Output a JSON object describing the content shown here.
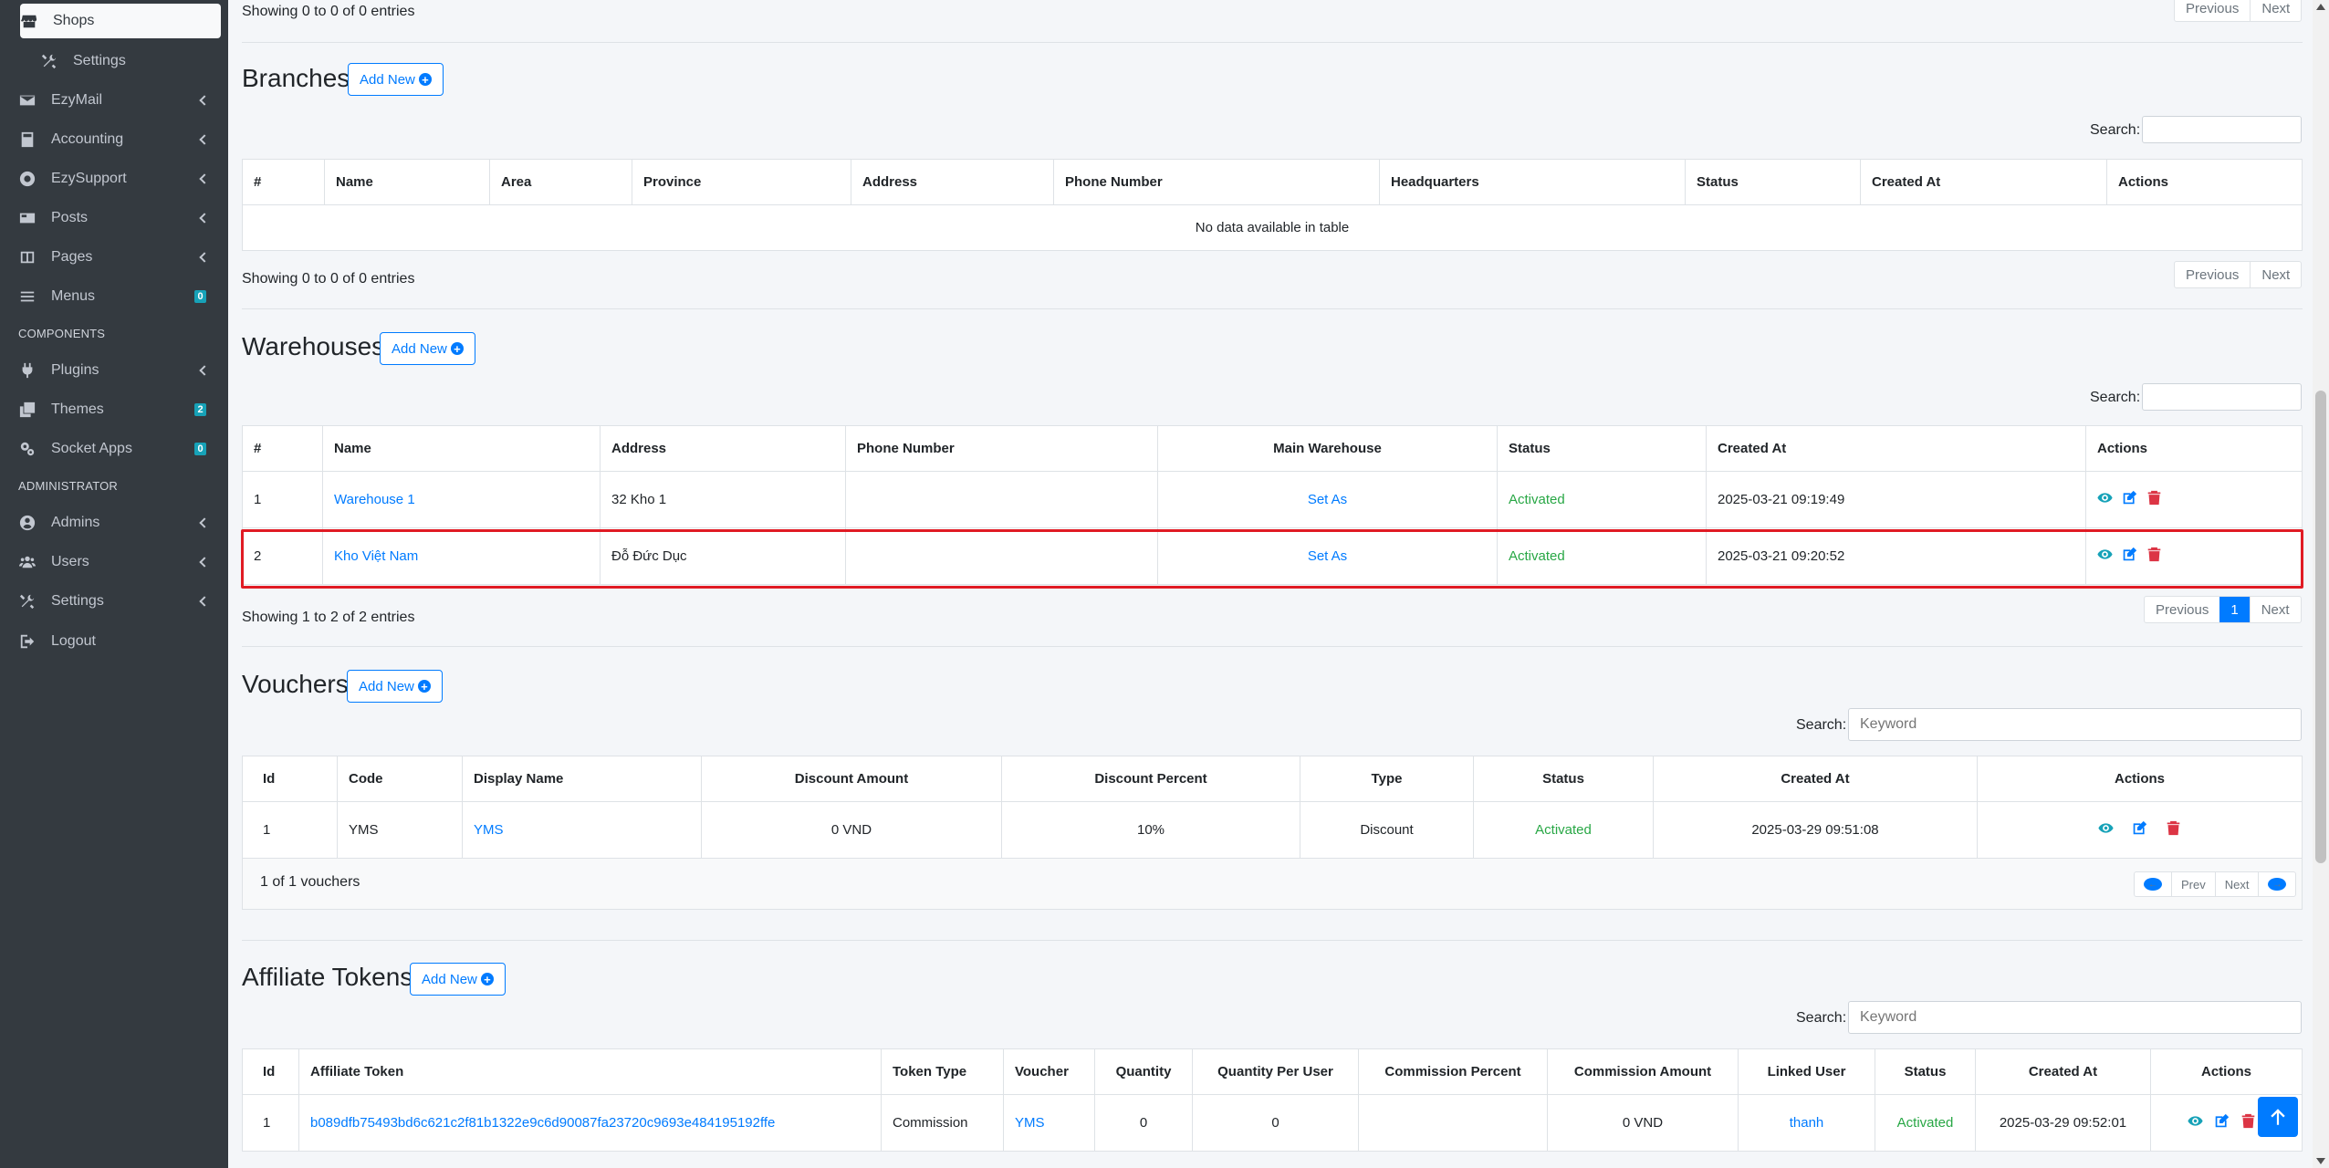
{
  "sidebar": {
    "items": [
      {
        "label": "Shops",
        "icon": "store-icon"
      },
      {
        "label": "Settings",
        "icon": "tools-icon"
      },
      {
        "label": "EzyMail",
        "icon": "envelope-icon"
      },
      {
        "label": "Accounting",
        "icon": "calculator-icon"
      },
      {
        "label": "EzySupport",
        "icon": "lifebuoy-icon"
      },
      {
        "label": "Posts",
        "icon": "newspaper-icon"
      },
      {
        "label": "Pages",
        "icon": "columns-icon"
      },
      {
        "label": "Menus",
        "icon": "bars-icon",
        "badge": "0"
      },
      {
        "label": "Plugins",
        "icon": "plug-icon"
      },
      {
        "label": "Themes",
        "icon": "clone-icon",
        "badge": "2"
      },
      {
        "label": "Socket Apps",
        "icon": "cogs-icon",
        "badge": "0"
      },
      {
        "label": "Admins",
        "icon": "user-circle-icon"
      },
      {
        "label": "Users",
        "icon": "users-icon"
      },
      {
        "label": "Settings",
        "icon": "tools-icon"
      },
      {
        "label": "Logout",
        "icon": "sign-out-icon"
      }
    ],
    "headers": {
      "components": "COMPONENTS",
      "administrator": "ADMINISTRATOR"
    }
  },
  "top": {
    "info": "Showing 0 to 0 of 0 entries",
    "prev": "Previous",
    "next": "Next"
  },
  "branches": {
    "title": "Branches",
    "add_label": "Add New",
    "search_label": "Search:",
    "columns": [
      "#",
      "Name",
      "Area",
      "Province",
      "Address",
      "Phone Number",
      "Headquarters",
      "Status",
      "Created At",
      "Actions"
    ],
    "empty": "No data available in table",
    "info": "Showing 0 to 0 of 0 entries",
    "prev": "Previous",
    "next": "Next"
  },
  "warehouses": {
    "title": "Warehouses",
    "add_label": "Add New",
    "search_label": "Search:",
    "columns": [
      "#",
      "Name",
      "Address",
      "Phone Number",
      "Main Warehouse",
      "Status",
      "Created At",
      "Actions"
    ],
    "rows": [
      {
        "id": "1",
        "name": "Warehouse 1",
        "address": "32 Kho 1",
        "phone": "",
        "main": "Set As",
        "status": "Activated",
        "created": "2025-03-21 09:19:49"
      },
      {
        "id": "2",
        "name": "Kho Việt Nam",
        "address": "Đỗ Đức Dục",
        "phone": "",
        "main": "Set As",
        "status": "Activated",
        "created": "2025-03-21 09:20:52"
      }
    ],
    "info": "Showing 1 to 2 of 2 entries",
    "prev": "Previous",
    "page": "1",
    "next": "Next"
  },
  "vouchers": {
    "title": "Vouchers",
    "add_label": "Add New",
    "search_label": "Search:",
    "search_placeholder": "Keyword",
    "columns": [
      "Id",
      "Code",
      "Display Name",
      "Discount Amount",
      "Discount Percent",
      "Type",
      "Status",
      "Created At",
      "Actions"
    ],
    "rows": [
      {
        "id": "1",
        "code": "YMS",
        "display": "YMS",
        "amount": "0 VND",
        "percent": "10%",
        "type": "Discount",
        "status": "Activated",
        "created": "2025-03-29 09:51:08"
      }
    ],
    "info": "1 of 1 vouchers",
    "prev": "Prev",
    "next": "Next"
  },
  "affiliate": {
    "title": "Affiliate Tokens",
    "add_label": "Add New",
    "search_label": "Search:",
    "search_placeholder": "Keyword",
    "columns": [
      "Id",
      "Affiliate Token",
      "Token Type",
      "Voucher",
      "Quantity",
      "Quantity Per User",
      "Commission Percent",
      "Commission Amount",
      "Linked User",
      "Status",
      "Created At",
      "Actions"
    ],
    "rows": [
      {
        "id": "1",
        "token": "b089dfb75493bd6c621c2f81b1322e9c6d90087fa23720c9693e484195192ffe",
        "type": "Commission",
        "voucher": "YMS",
        "quantity": "0",
        "qpu": "0",
        "cpercent": "",
        "camount": "0 VND",
        "user": "thanh",
        "status": "Activated",
        "created": "2025-03-29 09:52:01"
      }
    ]
  },
  "colors": {
    "primary": "#007bff",
    "success": "#28a745",
    "danger": "#dc3545",
    "info": "#17a2b8",
    "sidebar": "#343a40",
    "highlight": "#e01b24"
  }
}
